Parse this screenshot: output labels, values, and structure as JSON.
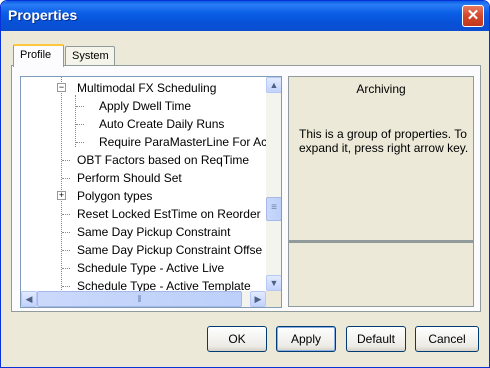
{
  "window": {
    "title": "Properties",
    "close_glyph": "✕"
  },
  "tabs": [
    {
      "label": "Profile",
      "active": true
    },
    {
      "label": "System",
      "active": false
    }
  ],
  "tree": {
    "items": [
      {
        "label": "Multimodal FX Scheduling",
        "expanded": true,
        "expander": "−",
        "level": 0
      },
      {
        "label": "Apply Dwell Time",
        "level": 1
      },
      {
        "label": "Auto Create Daily Runs",
        "level": 1
      },
      {
        "label": "Require ParaMasterLine For Ac",
        "level": 1
      },
      {
        "label": "OBT Factors based on ReqTime",
        "level": 0
      },
      {
        "label": "Perform Should Set",
        "level": 0
      },
      {
        "label": "Polygon types",
        "expanded": false,
        "expander": "+",
        "level": 0
      },
      {
        "label": "Reset Locked EstTime on Reorder",
        "level": 0
      },
      {
        "label": "Same Day Pickup Constraint",
        "level": 0
      },
      {
        "label": "Same Day Pickup Constraint Offse",
        "level": 0
      },
      {
        "label": "Schedule Type - Active Live",
        "level": 0
      },
      {
        "label": "Schedule Type - Active Template",
        "level": 0
      }
    ],
    "vscroll": {
      "up": "▲",
      "down": "▼",
      "thumb_glyph": "≡"
    },
    "hscroll": {
      "left": "◀",
      "right": "▶",
      "thumb_glyph": "⦀"
    }
  },
  "description": {
    "title": "Archiving",
    "body": "This is a group of properties. To expand it, press right arrow key."
  },
  "buttons": {
    "ok": "OK",
    "apply": "Apply",
    "default": "Default",
    "cancel": "Cancel"
  }
}
